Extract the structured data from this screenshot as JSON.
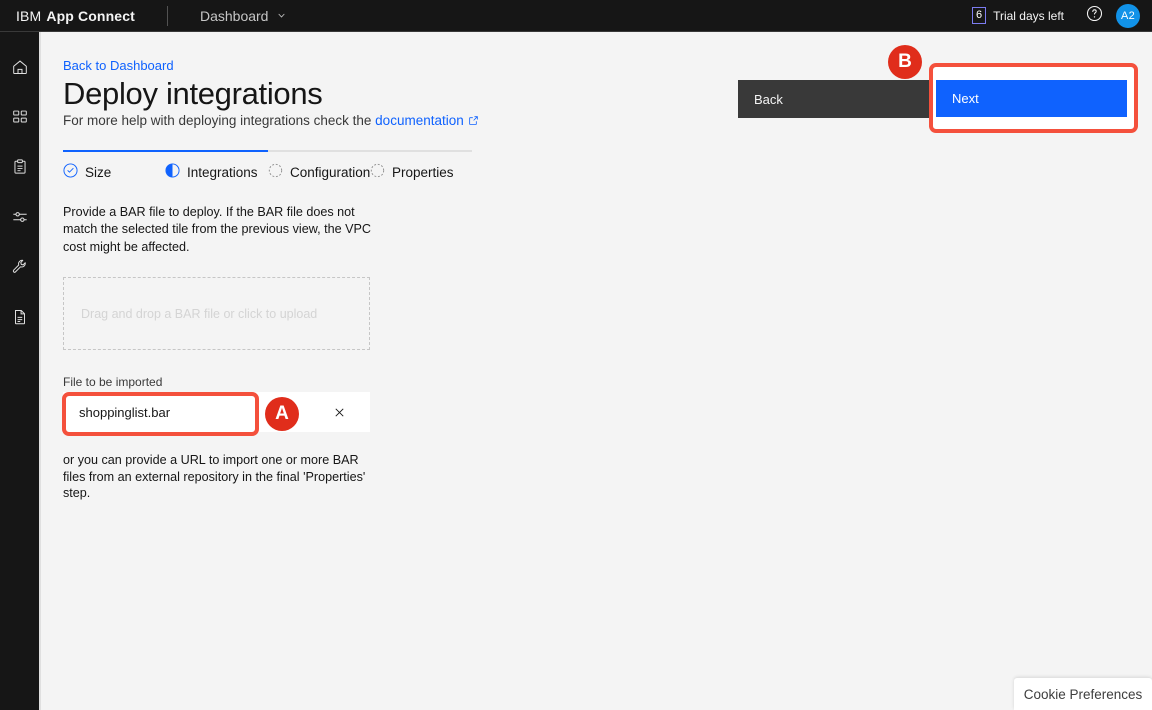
{
  "header": {
    "brand_ibm": "IBM",
    "brand_product": "App Connect",
    "nav_label": "Dashboard",
    "nav_chevron_icon": "chevron-down-icon",
    "trial_count": "6",
    "trial_label": "Trial days left",
    "help_icon": "help-icon",
    "avatar_initials": "A2"
  },
  "rail": {
    "items": [
      {
        "icon": "home-icon",
        "name": "sidebar-item-home"
      },
      {
        "icon": "apps-grid-icon",
        "name": "sidebar-item-catalog"
      },
      {
        "icon": "clipboard-icon",
        "name": "sidebar-item-dashboard"
      },
      {
        "icon": "sliders-icon",
        "name": "sidebar-item-settings"
      },
      {
        "icon": "wrench-icon",
        "name": "sidebar-item-tools"
      },
      {
        "icon": "document-icon",
        "name": "sidebar-item-docs"
      }
    ]
  },
  "page": {
    "back_link": "Back to Dashboard",
    "title": "Deploy integrations",
    "subtitle_prefix": "For more help with deploying integrations check the ",
    "subtitle_link": "documentation",
    "external_link_icon": "external-link-icon"
  },
  "progress": {
    "fill_percent": 50,
    "steps": [
      {
        "label": "Size",
        "state": "complete",
        "icon": "check-circle-icon"
      },
      {
        "label": "Integrations",
        "state": "current",
        "icon": "half-circle-icon"
      },
      {
        "label": "Configuration",
        "state": "incomplete",
        "icon": "dashed-circle-icon"
      },
      {
        "label": "Properties",
        "state": "incomplete",
        "icon": "dashed-circle-icon"
      }
    ]
  },
  "body": {
    "description": "Provide a BAR file to deploy. If the BAR file does not match the selected tile from the previous view, the VPC cost might be affected.",
    "dropzone_placeholder": "Drag and drop a BAR file or click to upload",
    "file_label": "File to be imported",
    "file_name": "shoppinglist.bar",
    "file_close_icon": "close-icon",
    "url_note": "or you can provide a URL to import one or more BAR files from an external repository in the final 'Properties' step."
  },
  "actions": {
    "back_label": "Back",
    "next_label": "Next"
  },
  "annotations": [
    {
      "label": "A",
      "target": "file-name-input"
    },
    {
      "label": "B",
      "target": "next-button"
    }
  ],
  "cookie": {
    "label": "Cookie Preferences"
  },
  "colors": {
    "header_bg": "#161616",
    "page_bg": "#f4f4f4",
    "accent_blue": "#0f62fe",
    "link_blue": "#0f62fe",
    "back_btn_bg": "#393939",
    "annotation_red": "#f4503c",
    "badge_red": "#e02d1b",
    "avatar_blue": "#1192e8",
    "trial_border": "#7c7cf0"
  }
}
